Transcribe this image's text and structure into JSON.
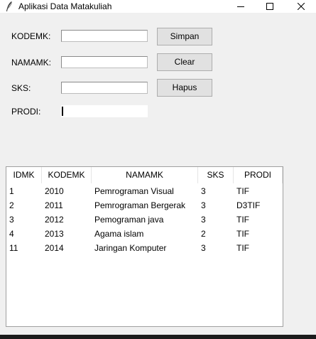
{
  "window": {
    "title": "Aplikasi Data Matakuliah",
    "icon": "feather-icon",
    "controls": [
      "minimize-icon",
      "maximize-icon",
      "close-icon"
    ]
  },
  "form": {
    "kodemk_label": "KODEMK:",
    "namamk_label": "NAMAMK:",
    "sks_label": "SKS:",
    "prodi_label": "PRODI:",
    "kodemk_value": "",
    "namamk_value": "",
    "sks_value": "",
    "prodi_value": ""
  },
  "buttons": {
    "simpan": "Simpan",
    "clear": "Clear",
    "hapus": "Hapus"
  },
  "table": {
    "headers": [
      "IDMK",
      "KODEMK",
      "NAMAMK",
      "SKS",
      "PRODI"
    ],
    "rows": [
      [
        "1",
        "2010",
        "Pemrograman Visual",
        "3",
        "TIF"
      ],
      [
        "2",
        "2011",
        "Pemrograman Bergerak",
        "3",
        "D3TIF"
      ],
      [
        "3",
        "2012",
        "Pemograman java",
        "3",
        "TIF"
      ],
      [
        "4",
        "2013",
        "Agama islam",
        "2",
        "TIF"
      ],
      [
        "11",
        "2014",
        "Jaringan Komputer",
        "3",
        "TIF"
      ]
    ]
  }
}
